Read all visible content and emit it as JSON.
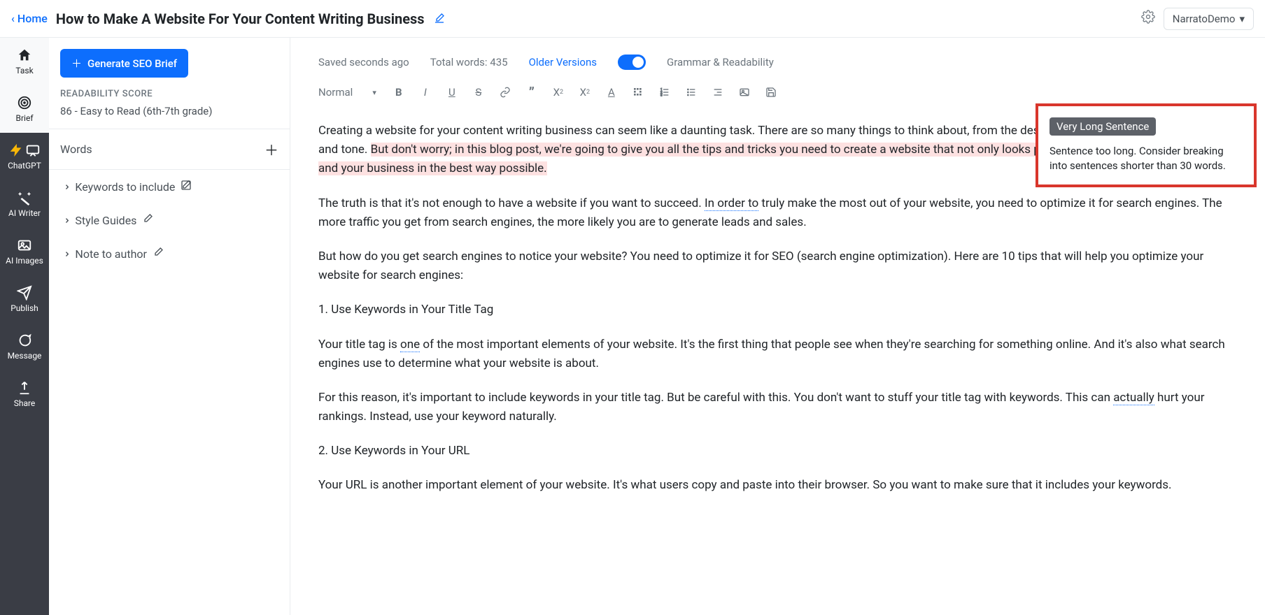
{
  "header": {
    "home": "Home",
    "title": "How to Make A Website For Your Content Writing Business",
    "user": "NarratoDemo"
  },
  "nav": {
    "task": "Task",
    "brief": "Brief",
    "chatgpt": "ChatGPT",
    "ai_writer": "AI Writer",
    "ai_images": "AI Images",
    "publish": "Publish",
    "message": "Message",
    "share": "Share"
  },
  "left": {
    "seo_btn": "Generate SEO Brief",
    "readability_head": "READABILITY SCORE",
    "readability_val": "86 - Easy to Read (6th-7th grade)",
    "words": "Words",
    "keywords": "Keywords to include",
    "style_guides": "Style Guides",
    "note": "Note to author"
  },
  "editor": {
    "saved": "Saved seconds ago",
    "total": "Total words: 435",
    "older": "Older Versions",
    "grammar": "Grammar & Readability",
    "normal": "Normal"
  },
  "content": {
    "p1a": "Creating a website for your content writing business can seem like a daunting task. There are so many things to think about, from the design and structure to the navigation and tone. ",
    "p1b": "But don't worry; in this blog post, we're going to give you all the tips and tricks you need to create a website that not only looks professiona",
    "p1c": "l, but also represents you and your business in the best way possible.",
    "p2a": "The truth is that it's not enough to have a website if you want to succeed. ",
    "p2b": "In order to",
    "p2c": " truly make the most out of your website, you need to optimize it for search engines. The more traffic you get from search engines, the more likely you are to generate leads and sales.",
    "p3": "But how do you get search engines to notice your website? You need to optimize it for SEO (search engine optimization). Here are 10 tips that will help you optimize your website for search engines:",
    "h1": "1. Use Keywords in Your Title Tag",
    "p4a": "Your title tag is ",
    "p4b": "one",
    "p4c": " of the most important elements of your website. It's the first thing that people see when they're searching for something online. And it's also what search engines use to determine what your website is about.",
    "p5a": "For this reason, it's important to include keywords in your title tag. But be careful with this. You don't want to stuff your title tag with keywords. This can ",
    "p5b": "actually",
    "p5c": " hurt your rankings. Instead, use your keyword naturally.",
    "h2": "2. Use Keywords in Your URL",
    "p6": "Your URL is another important element of your website. It's what users copy and paste into their browser. So you want to make sure that it includes your keywords."
  },
  "suggestion": {
    "badge": "Very Long Sentence",
    "text": "Sentence too long. Consider breaking into sentences shorter than 30 words."
  }
}
